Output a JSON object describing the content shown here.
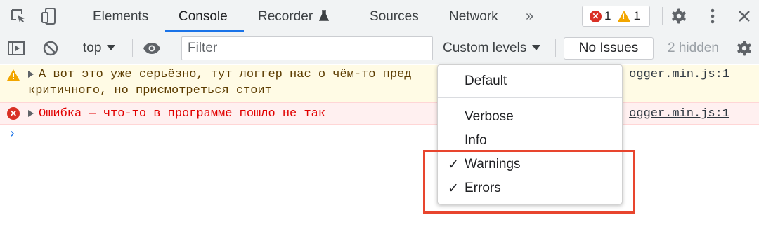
{
  "tabs": {
    "items": [
      {
        "label": "Elements",
        "active": false
      },
      {
        "label": "Console",
        "active": true
      },
      {
        "label": "Recorder",
        "active": false
      },
      {
        "label": "Sources",
        "active": false
      },
      {
        "label": "Network",
        "active": false
      }
    ],
    "more": "»",
    "error_count": "1",
    "warning_count": "1"
  },
  "toolbar": {
    "context": "top",
    "filter_placeholder": "Filter",
    "levels_label": "Custom levels",
    "no_issues_label": "No Issues",
    "hidden_label": "2 hidden"
  },
  "messages": [
    {
      "level": "warning",
      "line1": "А вот это уже серьёзно, тут логгер нас о чём-то пред",
      "line2": "критичного, но присмотреться стоит",
      "source": "ogger.min.js:1"
    },
    {
      "level": "error",
      "line1": "Ошибка — что-то в программе пошло не так",
      "source": "ogger.min.js:1"
    }
  ],
  "prompt_symbol": "›",
  "levels_menu": {
    "items": [
      {
        "label": "Default",
        "checked": false
      },
      {
        "label": "Verbose",
        "checked": false
      },
      {
        "label": "Info",
        "checked": false
      },
      {
        "label": "Warnings",
        "checked": true
      },
      {
        "label": "Errors",
        "checked": true
      }
    ],
    "check_symbol": "✓"
  },
  "colors": {
    "accent": "#1a73e8",
    "error": "#d93025",
    "warning": "#f2a600",
    "highlight": "#e8452e"
  }
}
